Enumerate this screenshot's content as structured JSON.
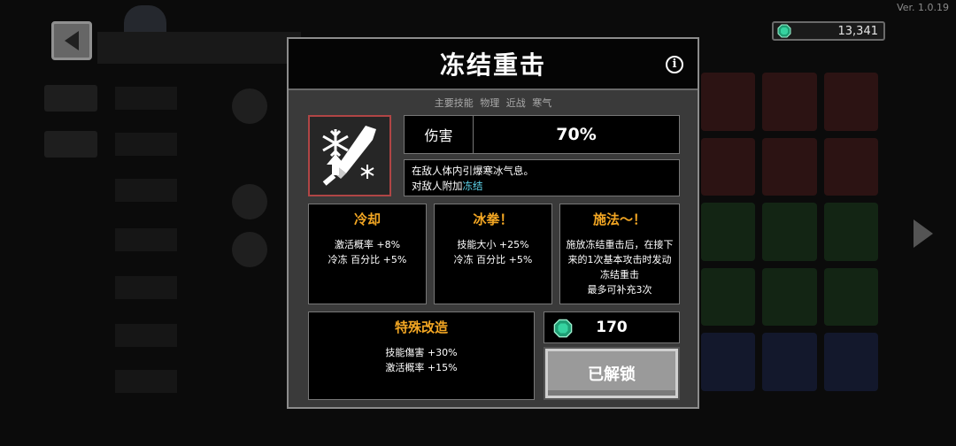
{
  "version": "Ver. 1.0.19",
  "currency": {
    "amount": "13,341",
    "icon": "emerald-gem-icon",
    "color": "#2bbf8a"
  },
  "modal": {
    "title": "冻结重击",
    "tags": "主要技能 物理 近战 寒气",
    "damage": {
      "label": "伤害",
      "value": "70%"
    },
    "description": {
      "line1": "在敌人体内引爆寒冰气息。",
      "line2_prefix": "对敌人附加",
      "line2_highlight": "冻结"
    },
    "modifiers": [
      {
        "title": "冷却",
        "lines": [
          "激活概率 +8%",
          "冷冻 百分比 +5%"
        ]
      },
      {
        "title": "冰拳！",
        "lines": [
          "技能大小 +25%",
          "冷冻 百分比 +5%"
        ]
      },
      {
        "title": "施法～！",
        "lines": [
          "施放冻结重击后，在接下",
          "来的1次基本攻击时发动",
          "冻结重击",
          "最多可补充3次"
        ]
      }
    ],
    "special": {
      "title": "特殊改造",
      "lines": [
        "技能傷害 +30%",
        "激活概率 +15%"
      ]
    },
    "cost": {
      "value": "170",
      "icon": "emerald-gem-icon"
    },
    "unlock_label": "已解锁"
  },
  "colors": {
    "accent": "#f2a623",
    "freeze": "#5fd7ee",
    "icon_border": "#b04545"
  }
}
